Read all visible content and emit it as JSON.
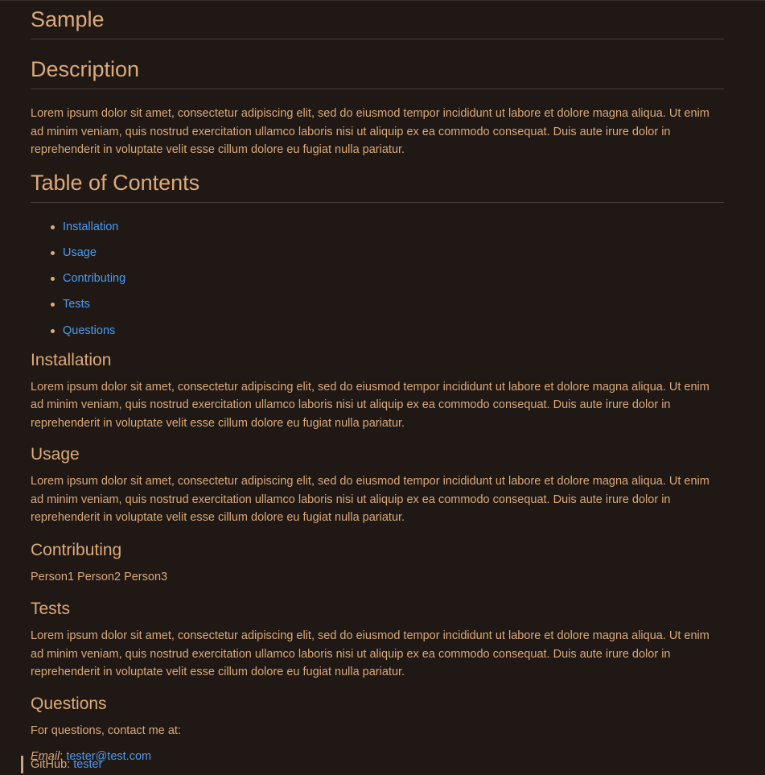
{
  "title": "Sample",
  "description": {
    "heading": "Description",
    "text": "Lorem ipsum dolor sit amet, consectetur adipiscing elit, sed do eiusmod tempor incididunt ut labore et dolore magna aliqua. Ut enim ad minim veniam, quis nostrud exercitation ullamco laboris nisi ut aliquip ex ea commodo consequat. Duis aute irure dolor in reprehenderit in voluptate velit esse cillum dolore eu fugiat nulla pariatur."
  },
  "toc": {
    "heading": "Table of Contents",
    "items": [
      {
        "label": "Installation"
      },
      {
        "label": "Usage"
      },
      {
        "label": "Contributing"
      },
      {
        "label": "Tests"
      },
      {
        "label": "Questions"
      }
    ]
  },
  "installation": {
    "heading": "Installation",
    "text": "Lorem ipsum dolor sit amet, consectetur adipiscing elit, sed do eiusmod tempor incididunt ut labore et dolore magna aliqua. Ut enim ad minim veniam, quis nostrud exercitation ullamco laboris nisi ut aliquip ex ea commodo consequat. Duis aute irure dolor in reprehenderit in voluptate velit esse cillum dolore eu fugiat nulla pariatur."
  },
  "usage": {
    "heading": "Usage",
    "text": "Lorem ipsum dolor sit amet, consectetur adipiscing elit, sed do eiusmod tempor incididunt ut labore et dolore magna aliqua. Ut enim ad minim veniam, quis nostrud exercitation ullamco laboris nisi ut aliquip ex ea commodo consequat. Duis aute irure dolor in reprehenderit in voluptate velit esse cillum dolore eu fugiat nulla pariatur."
  },
  "contributing": {
    "heading": "Contributing",
    "text": "Person1 Person2 Person3"
  },
  "tests": {
    "heading": "Tests",
    "text": "Lorem ipsum dolor sit amet, consectetur adipiscing elit, sed do eiusmod tempor incididunt ut labore et dolore magna aliqua. Ut enim ad minim veniam, quis nostrud exercitation ullamco laboris nisi ut aliquip ex ea commodo consequat. Duis aute irure dolor in reprehenderit in voluptate velit esse cillum dolore eu fugiat nulla pariatur."
  },
  "questions": {
    "heading": "Questions",
    "intro": "For questions, contact me at:",
    "email_label": "Email",
    "email_sep": ": ",
    "email": "tester@test.com",
    "github_label": "GitHub: ",
    "github": "tester"
  },
  "colors": {
    "background": "#201814",
    "text": "#d9a97a",
    "link": "#4b9cf2",
    "rule": "#4a3f38"
  }
}
